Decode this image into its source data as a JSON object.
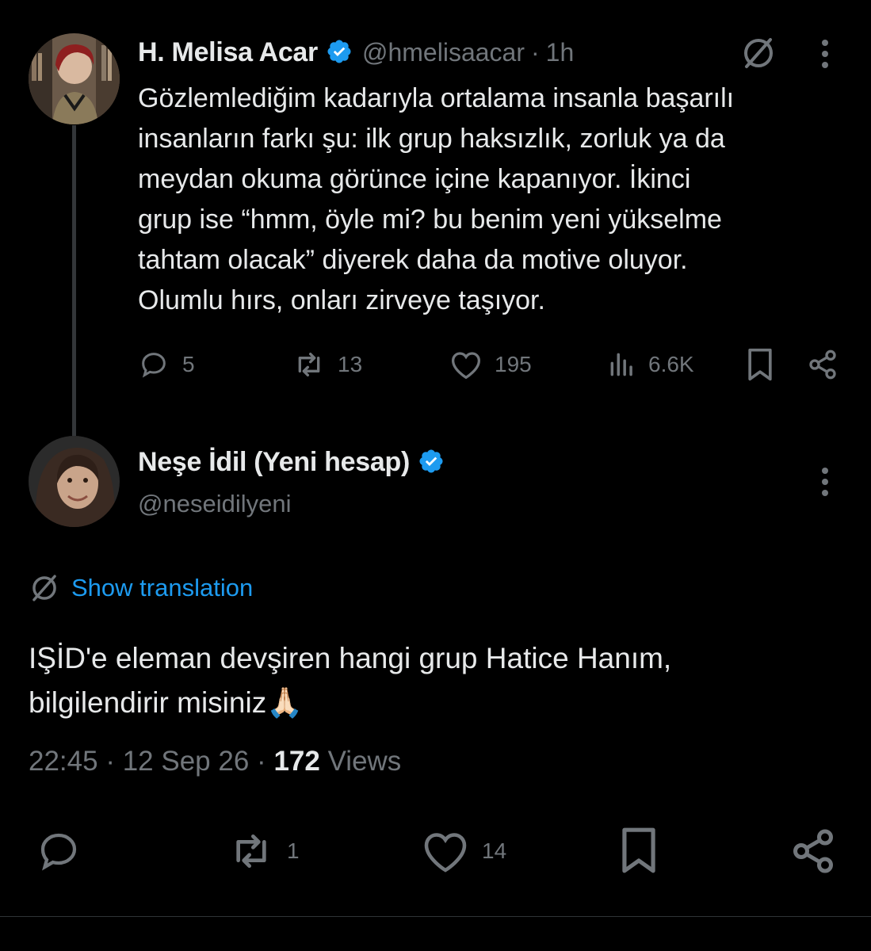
{
  "parent_tweet": {
    "author_name": "H. Melisa Acar",
    "handle": "@hmelisaacar",
    "separator": "·",
    "time": "1h",
    "text_lines": [
      "Gözlemlediğim kadarıyla ortalama insanla başarılı",
      "insanların farkı şu: ilk grup haksızlık, zorluk ya da",
      "meydan okuma görünce içine kapanıyor. İkinci",
      "grup ise “hmm, öyle mi? bu benim yeni yükselme",
      "tahtam olacak” diyerek daha da motive oluyor.",
      "Olumlu hırs, onları zirveye taşıyor."
    ],
    "stats": {
      "replies": "5",
      "reposts": "13",
      "likes": "195",
      "views": "6.6K"
    }
  },
  "reply_tweet": {
    "author_name": "Neşe İdil (Yeni hesap)",
    "handle": "@neseidilyeni",
    "show_translation": "Show translation",
    "text_line1": "IŞİD'e eleman devşiren hangi grup Hatice Hanım,",
    "text_line2": "bilgilendirir misiniz",
    "emoji": "🙏🏻",
    "time": "22:45",
    "dot": "·",
    "date": "12 Sep 26",
    "views_count": "172",
    "views_label": "Views",
    "stats": {
      "reposts": "1",
      "likes": "14"
    }
  },
  "colors": {
    "background": "#000000",
    "text": "#e7e9ea",
    "muted": "#71767b",
    "link": "#1d9bf0",
    "verified": "#1d9bf0"
  }
}
